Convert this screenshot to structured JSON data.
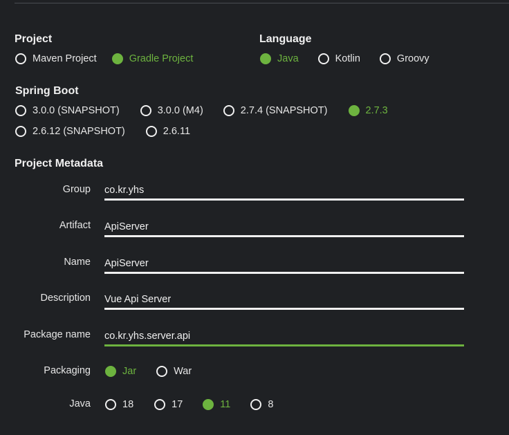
{
  "project": {
    "title": "Project",
    "options": [
      {
        "label": "Maven Project",
        "checked": false
      },
      {
        "label": "Gradle Project",
        "checked": true
      }
    ]
  },
  "language": {
    "title": "Language",
    "options": [
      {
        "label": "Java",
        "checked": true
      },
      {
        "label": "Kotlin",
        "checked": false
      },
      {
        "label": "Groovy",
        "checked": false
      }
    ]
  },
  "spring_boot": {
    "title": "Spring Boot",
    "options": [
      {
        "label": "3.0.0 (SNAPSHOT)",
        "checked": false
      },
      {
        "label": "3.0.0 (M4)",
        "checked": false
      },
      {
        "label": "2.7.4 (SNAPSHOT)",
        "checked": false
      },
      {
        "label": "2.7.3",
        "checked": true
      },
      {
        "label": "2.6.12 (SNAPSHOT)",
        "checked": false
      },
      {
        "label": "2.6.11",
        "checked": false
      }
    ]
  },
  "metadata": {
    "title": "Project Metadata",
    "fields": [
      {
        "label": "Group",
        "value": "co.kr.yhs"
      },
      {
        "label": "Artifact",
        "value": "ApiServer"
      },
      {
        "label": "Name",
        "value": "ApiServer"
      },
      {
        "label": "Description",
        "value": "Vue Api Server"
      },
      {
        "label": "Package name",
        "value": "co.kr.yhs.server.api"
      }
    ],
    "packaging": {
      "label": "Packaging",
      "options": [
        {
          "label": "Jar",
          "checked": true
        },
        {
          "label": "War",
          "checked": false
        }
      ]
    },
    "java": {
      "label": "Java",
      "options": [
        {
          "label": "18",
          "checked": false
        },
        {
          "label": "17",
          "checked": false
        },
        {
          "label": "11",
          "checked": true
        },
        {
          "label": "8",
          "checked": false
        }
      ]
    }
  },
  "colors": {
    "accent": "#6db33f",
    "background": "#1f2124",
    "text": "#e8e8e8"
  }
}
